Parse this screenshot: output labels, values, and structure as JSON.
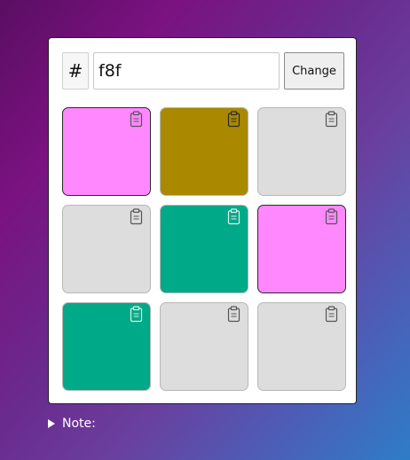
{
  "header": {
    "hash_symbol": "#",
    "hex_value": "f8f",
    "change_label": "Change"
  },
  "swatches": [
    {
      "color": "#ff88ff",
      "selected": true
    },
    {
      "color": "#aa8800",
      "selected": false
    },
    {
      "color": "#dddddd",
      "selected": false
    },
    {
      "color": "#dddddd",
      "selected": false
    },
    {
      "color": "#00aa88",
      "selected": false
    },
    {
      "color": "#ff88ff",
      "selected": true
    },
    {
      "color": "#00aa88",
      "selected": false
    },
    {
      "color": "#dddddd",
      "selected": false
    },
    {
      "color": "#dddddd",
      "selected": false
    }
  ],
  "icons": {
    "copy": "clipboard-icon",
    "disclosure": "triangle-right-icon"
  },
  "note": {
    "label": "Note:"
  }
}
